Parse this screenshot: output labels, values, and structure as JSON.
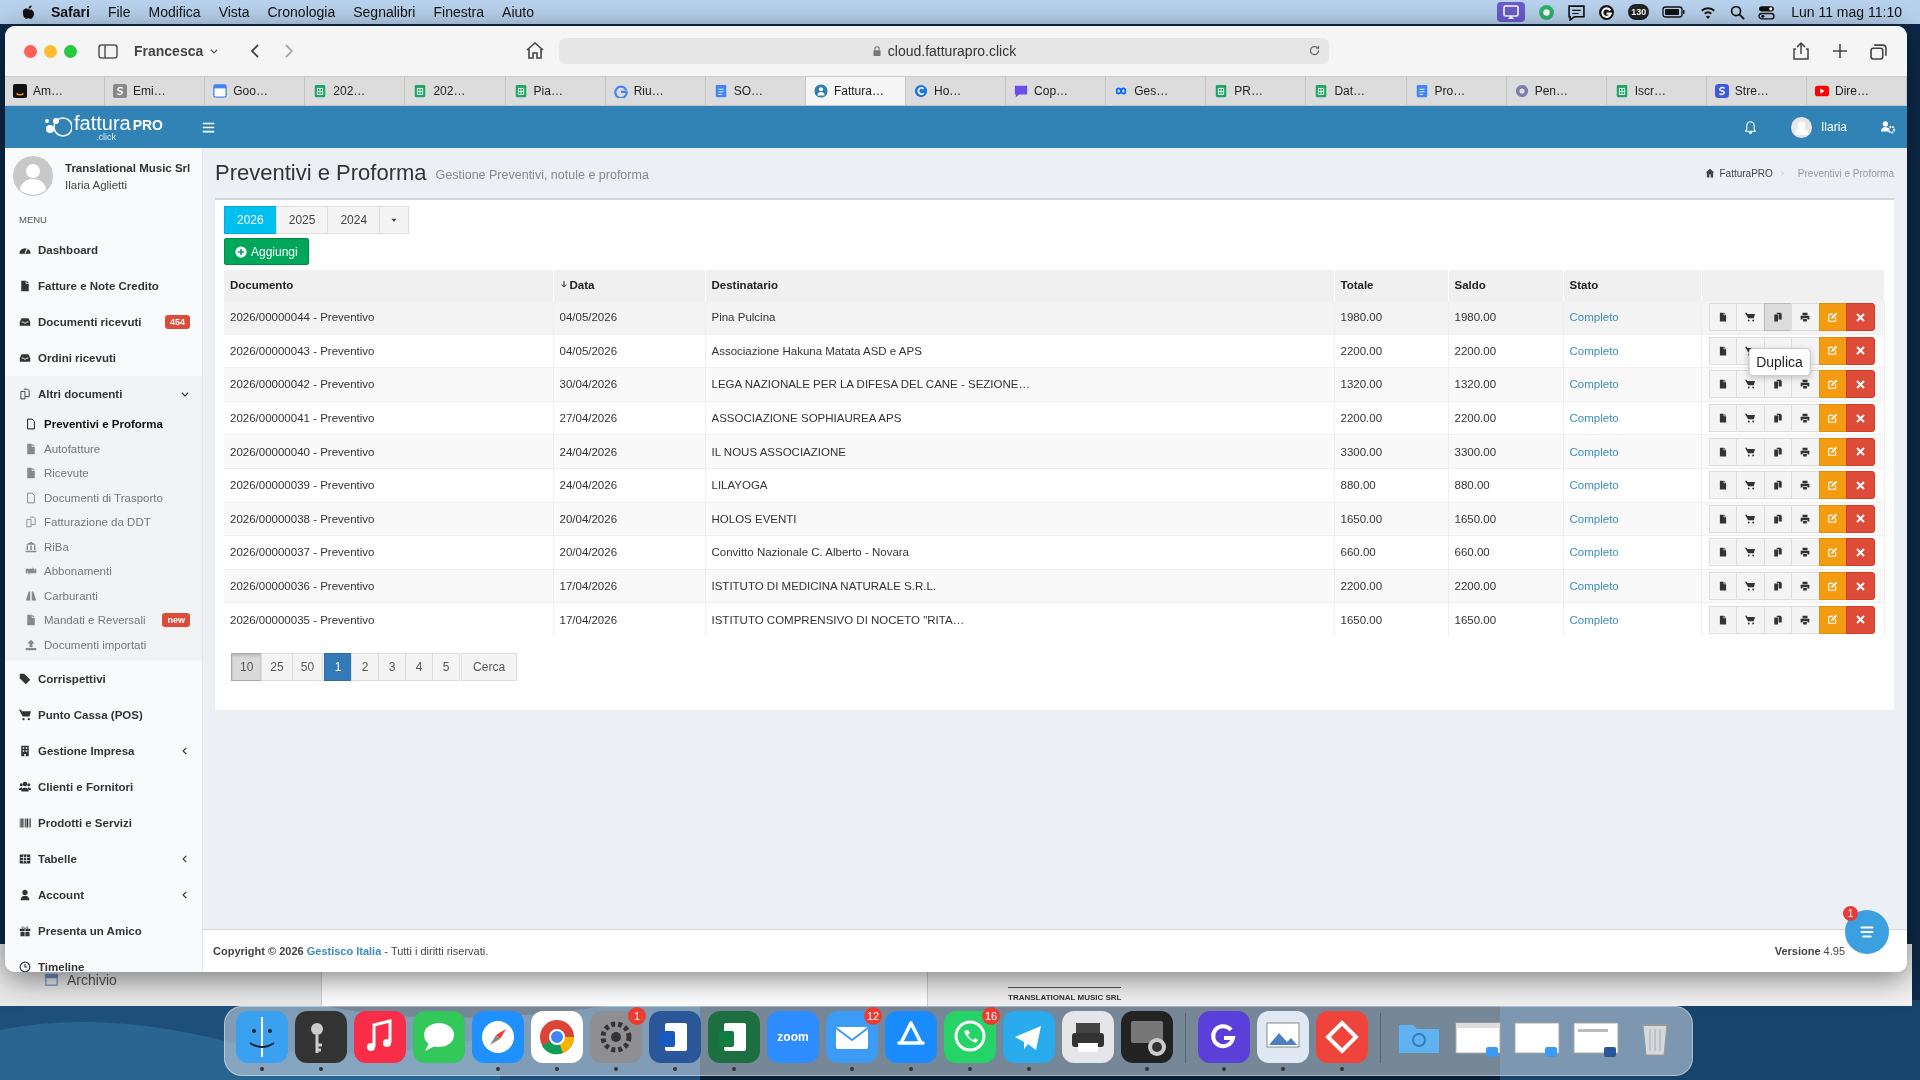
{
  "menubar": {
    "app": "Safari",
    "items": [
      "File",
      "Modifica",
      "Vista",
      "Cronologia",
      "Segnalibri",
      "Finestra",
      "Aiuto"
    ],
    "status_badge": "130",
    "clock": "Lun 11 mag 11:10"
  },
  "browser": {
    "profile": "Francesca",
    "address": "cloud.fatturapro.click",
    "tabs": [
      {
        "label": "Am…",
        "selected": false
      },
      {
        "label": "Emi…",
        "selected": false
      },
      {
        "label": "Goo…",
        "selected": false
      },
      {
        "label": "202…",
        "selected": false
      },
      {
        "label": "202…",
        "selected": false
      },
      {
        "label": "Pia…",
        "selected": false
      },
      {
        "label": "Riu…",
        "selected": false
      },
      {
        "label": "SO…",
        "selected": false
      },
      {
        "label": "Fattura…",
        "selected": true
      },
      {
        "label": "Ho…",
        "selected": false
      },
      {
        "label": "Cop…",
        "selected": false
      },
      {
        "label": "Ges…",
        "selected": false
      },
      {
        "label": "PR…",
        "selected": false
      },
      {
        "label": "Dat…",
        "selected": false
      },
      {
        "label": "Pro…",
        "selected": false
      },
      {
        "label": "Pen…",
        "selected": false
      },
      {
        "label": "Iscr…",
        "selected": false
      },
      {
        "label": "Stre…",
        "selected": false
      },
      {
        "label": "Dire…",
        "selected": false
      }
    ]
  },
  "header": {
    "logo": {
      "name": "fattura",
      "suffix": "PRO",
      "domain": ".click"
    },
    "user": "Ilaria"
  },
  "sidebar": {
    "company": "Translational Music Srl",
    "user": "Ilaria Aglietti",
    "menu_label": "MENU",
    "items": [
      {
        "label": "Dashboard",
        "selected": false
      },
      {
        "label": "Fatture e Note Credito",
        "selected": false
      },
      {
        "label": "Documenti ricevuti",
        "selected": false,
        "badge": "454"
      },
      {
        "label": "Ordini ricevuti",
        "selected": false
      },
      {
        "label": "Altri documenti",
        "selected": false,
        "expanded": true,
        "children": [
          {
            "label": "Preventivi e Proforma",
            "selected": true
          },
          {
            "label": "Autofatture",
            "selected": false
          },
          {
            "label": "Ricevute",
            "selected": false
          },
          {
            "label": "Documenti di Trasporto",
            "selected": false
          },
          {
            "label": "Fatturazione da DDT",
            "selected": false
          },
          {
            "label": "RiBa",
            "selected": false
          },
          {
            "label": "Abbonamenti",
            "selected": false
          },
          {
            "label": "Carburanti",
            "selected": false
          },
          {
            "label": "Mandati e Reversali",
            "selected": false,
            "badge": "new"
          },
          {
            "label": "Documenti importati",
            "selected": false
          }
        ]
      },
      {
        "label": "Corrispettivi",
        "selected": false
      },
      {
        "label": "Punto Cassa (POS)",
        "selected": false
      },
      {
        "label": "Gestione Impresa",
        "selected": false,
        "expanded": false
      },
      {
        "label": "Clienti e Fornitori",
        "selected": false
      },
      {
        "label": "Prodotti e Servizi",
        "selected": false
      },
      {
        "label": "Tabelle",
        "selected": false,
        "expanded": false
      },
      {
        "label": "Account",
        "selected": false,
        "expanded": false
      },
      {
        "label": "Presenta un Amico",
        "selected": false
      },
      {
        "label": "Timeline",
        "selected": false
      }
    ]
  },
  "page": {
    "title": "Preventivi e Proforma",
    "subtitle": "Gestione Preventivi, notule e proforma",
    "breadcrumb": [
      "FatturaPRO",
      "Preventivi e Proforma"
    ],
    "years": [
      {
        "label": "2026",
        "selected": true
      },
      {
        "label": "2025",
        "selected": false
      },
      {
        "label": "2024",
        "selected": false
      }
    ],
    "add_button": "Aggiungi",
    "table": {
      "columns": [
        {
          "label": "Documento",
          "sorted": false
        },
        {
          "label": "Data",
          "sorted": true
        },
        {
          "label": "Destinatario",
          "sorted": false
        },
        {
          "label": "Totale",
          "sorted": false
        },
        {
          "label": "Saldo",
          "sorted": false
        },
        {
          "label": "Stato",
          "sorted": false
        }
      ],
      "tooltip": "Duplica",
      "rows": [
        {
          "documento": "2026/00000044 - Preventivo",
          "data": "04/05/2026",
          "destinatario": "Pina Pulcina",
          "totale": "1980.00",
          "saldo": "1980.00",
          "stato": "Completo",
          "hovered": true
        },
        {
          "documento": "2026/00000043 - Preventivo",
          "data": "04/05/2026",
          "destinatario": "Associazione Hakuna Matata ASD e APS",
          "totale": "2200.00",
          "saldo": "2200.00",
          "stato": "Completo",
          "hovered": false
        },
        {
          "documento": "2026/00000042 - Preventivo",
          "data": "30/04/2026",
          "destinatario": "LEGA NAZIONALE PER LA DIFESA DEL CANE - SEZIONE…",
          "totale": "1320.00",
          "saldo": "1320.00",
          "stato": "Completo",
          "hovered": false
        },
        {
          "documento": "2026/00000041 - Preventivo",
          "data": "27/04/2026",
          "destinatario": "ASSOCIAZIONE SOPHIAUREA APS",
          "totale": "2200.00",
          "saldo": "2200.00",
          "stato": "Completo",
          "hovered": false
        },
        {
          "documento": "2026/00000040 - Preventivo",
          "data": "24/04/2026",
          "destinatario": "IL NOUS ASSOCIAZIONE",
          "totale": "3300.00",
          "saldo": "3300.00",
          "stato": "Completo",
          "hovered": false
        },
        {
          "documento": "2026/00000039 - Preventivo",
          "data": "24/04/2026",
          "destinatario": "LILAYOGA",
          "totale": "880.00",
          "saldo": "880.00",
          "stato": "Completo",
          "hovered": false
        },
        {
          "documento": "2026/00000038 - Preventivo",
          "data": "20/04/2026",
          "destinatario": "HOLOS EVENTI",
          "totale": "1650.00",
          "saldo": "1650.00",
          "stato": "Completo",
          "hovered": false
        },
        {
          "documento": "2026/00000037 - Preventivo",
          "data": "20/04/2026",
          "destinatario": "Convitto Nazionale C. Alberto - Novara",
          "totale": "660.00",
          "saldo": "660.00",
          "stato": "Completo",
          "hovered": false
        },
        {
          "documento": "2026/00000036 - Preventivo",
          "data": "17/04/2026",
          "destinatario": "ISTITUTO DI MEDICINA NATURALE S.R.L.",
          "totale": "2200.00",
          "saldo": "2200.00",
          "stato": "Completo",
          "hovered": false
        },
        {
          "documento": "2026/00000035 - Preventivo",
          "data": "17/04/2026",
          "destinatario": "ISTITUTO COMPRENSIVO DI NOCETO \"RITA…",
          "totale": "1650.00",
          "saldo": "1650.00",
          "stato": "Completo",
          "hovered": false
        }
      ]
    },
    "page_sizes": [
      {
        "label": "10",
        "selected": true
      },
      {
        "label": "25",
        "selected": false
      },
      {
        "label": "50",
        "selected": false
      }
    ],
    "pages": [
      {
        "label": "1",
        "selected": true
      },
      {
        "label": "2",
        "selected": false
      },
      {
        "label": "3",
        "selected": false
      },
      {
        "label": "4",
        "selected": false
      },
      {
        "label": "5",
        "selected": false
      }
    ],
    "search_button": "Cerca"
  },
  "footer": {
    "prefix": "Copyright © 2026",
    "link": "Gestisco Italia",
    "suffix": "- Tutti i diritti riservati.",
    "version": "**Versione** 4.95",
    "chat_badge": "1"
  },
  "back_window": {
    "title": "Archivio",
    "heading": "TRANSLATIONAL MUSIC SRL"
  },
  "dock": [
    {
      "running": true
    },
    {
      "running": true
    },
    {
      "running": false
    },
    {
      "running": false
    },
    {
      "running": true
    },
    {
      "running": true
    },
    {
      "running": true,
      "badge": "1"
    },
    {
      "running": true
    },
    {
      "running": true
    },
    {
      "running": false,
      "label": "zoom"
    },
    {
      "running": true,
      "badge": "12"
    },
    {
      "running": true
    },
    {
      "running": true,
      "badge": "16"
    },
    {
      "running": true
    },
    {
      "running": false
    },
    {
      "running": true
    },
    {
      "running": true
    },
    {
      "running": true
    },
    {
      "running": true
    },
    {
      "running": false
    },
    {
      "running": false
    },
    {
      "running": false
    },
    {
      "running": false
    },
    {
      "running": false
    }
  ]
}
